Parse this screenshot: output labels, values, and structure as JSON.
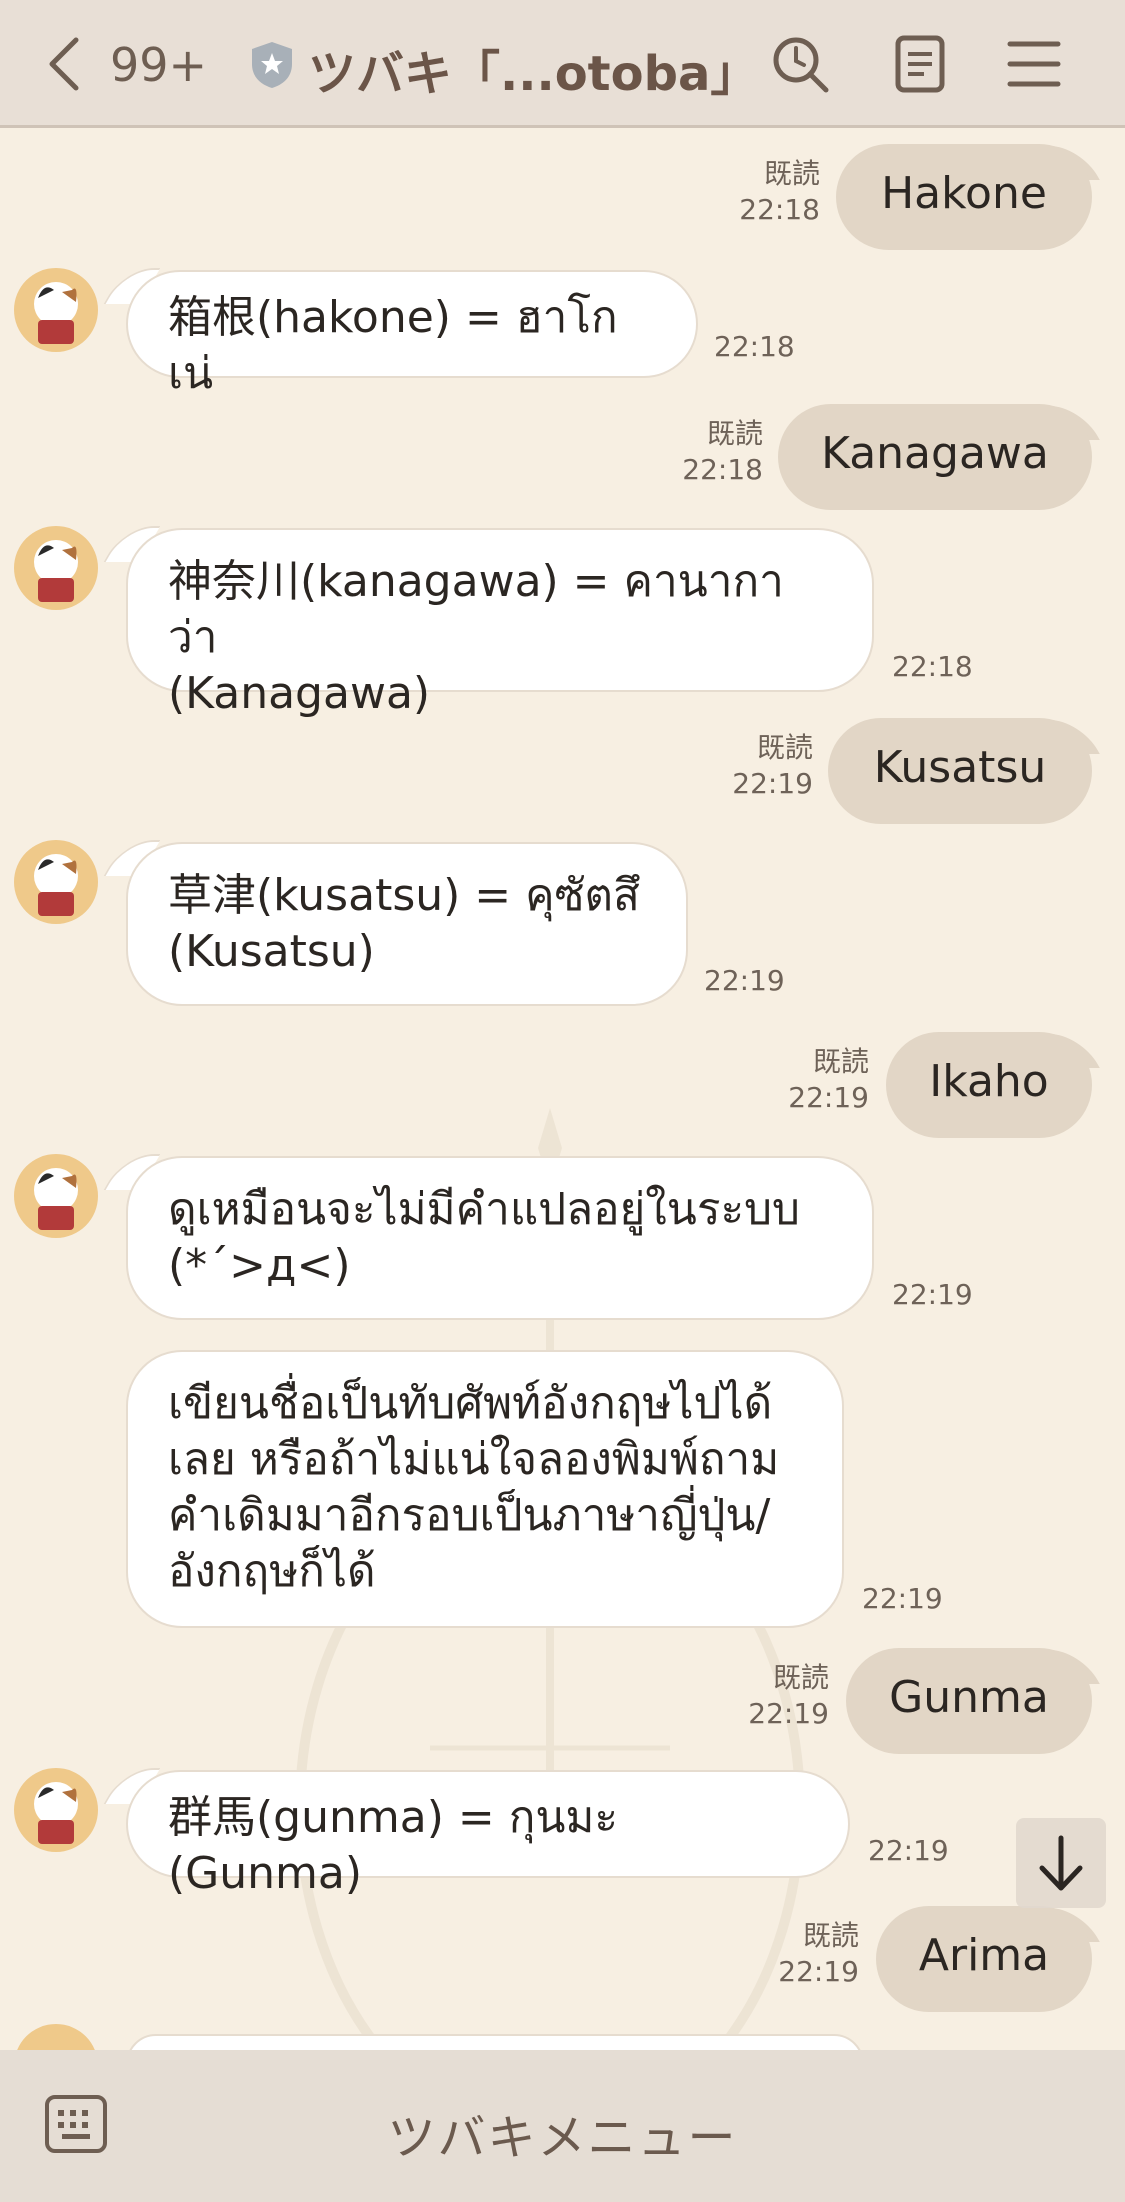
{
  "header": {
    "unread_count": "99+",
    "title": "ツバキ「...otoba」"
  },
  "messages": [
    {
      "dir": "out",
      "text": "Hakone",
      "read": "既読",
      "time": "22:18"
    },
    {
      "dir": "in",
      "text": "箱根(hakone) = ฮาโกเน่",
      "time": "22:18"
    },
    {
      "dir": "out",
      "text": "Kanagawa",
      "read": "既読",
      "time": "22:18"
    },
    {
      "dir": "in",
      "text": "神奈川(kanagawa) = คานากาว่า\n(Kanagawa)",
      "time": "22:18"
    },
    {
      "dir": "out",
      "text": "Kusatsu",
      "read": "既読",
      "time": "22:19"
    },
    {
      "dir": "in",
      "text": "草津(kusatsu) = คุซัตสึ\n(Kusatsu)",
      "time": "22:19"
    },
    {
      "dir": "out",
      "text": "Ikaho",
      "read": "既読",
      "time": "22:19"
    },
    {
      "dir": "in",
      "text": "ดูเหมือนจะไม่มีคำแปลอยู่ในระบบ\n(*´>д<)",
      "time": "22:19"
    },
    {
      "dir": "in",
      "text": "เขียนชื่อเป็นทับศัพท์อังกฤษไปได้\nเลย หรือถ้าไม่แน่ใจลองพิมพ์ถาม\nคำเดิมมาอีกรอบเป็นภาษาญี่ปุ่น/\nอังกฤษก็ได้",
      "time": "22:19"
    },
    {
      "dir": "out",
      "text": "Gunma",
      "read": "既読",
      "time": "22:19"
    },
    {
      "dir": "in",
      "text": "群馬(gunma) = กุนมะ (Gunma)",
      "time": "22:19"
    },
    {
      "dir": "out",
      "text": "Arima",
      "read": "既読",
      "time": "22:19"
    }
  ],
  "bottom": {
    "menu_label": "ツバキメニュー"
  }
}
